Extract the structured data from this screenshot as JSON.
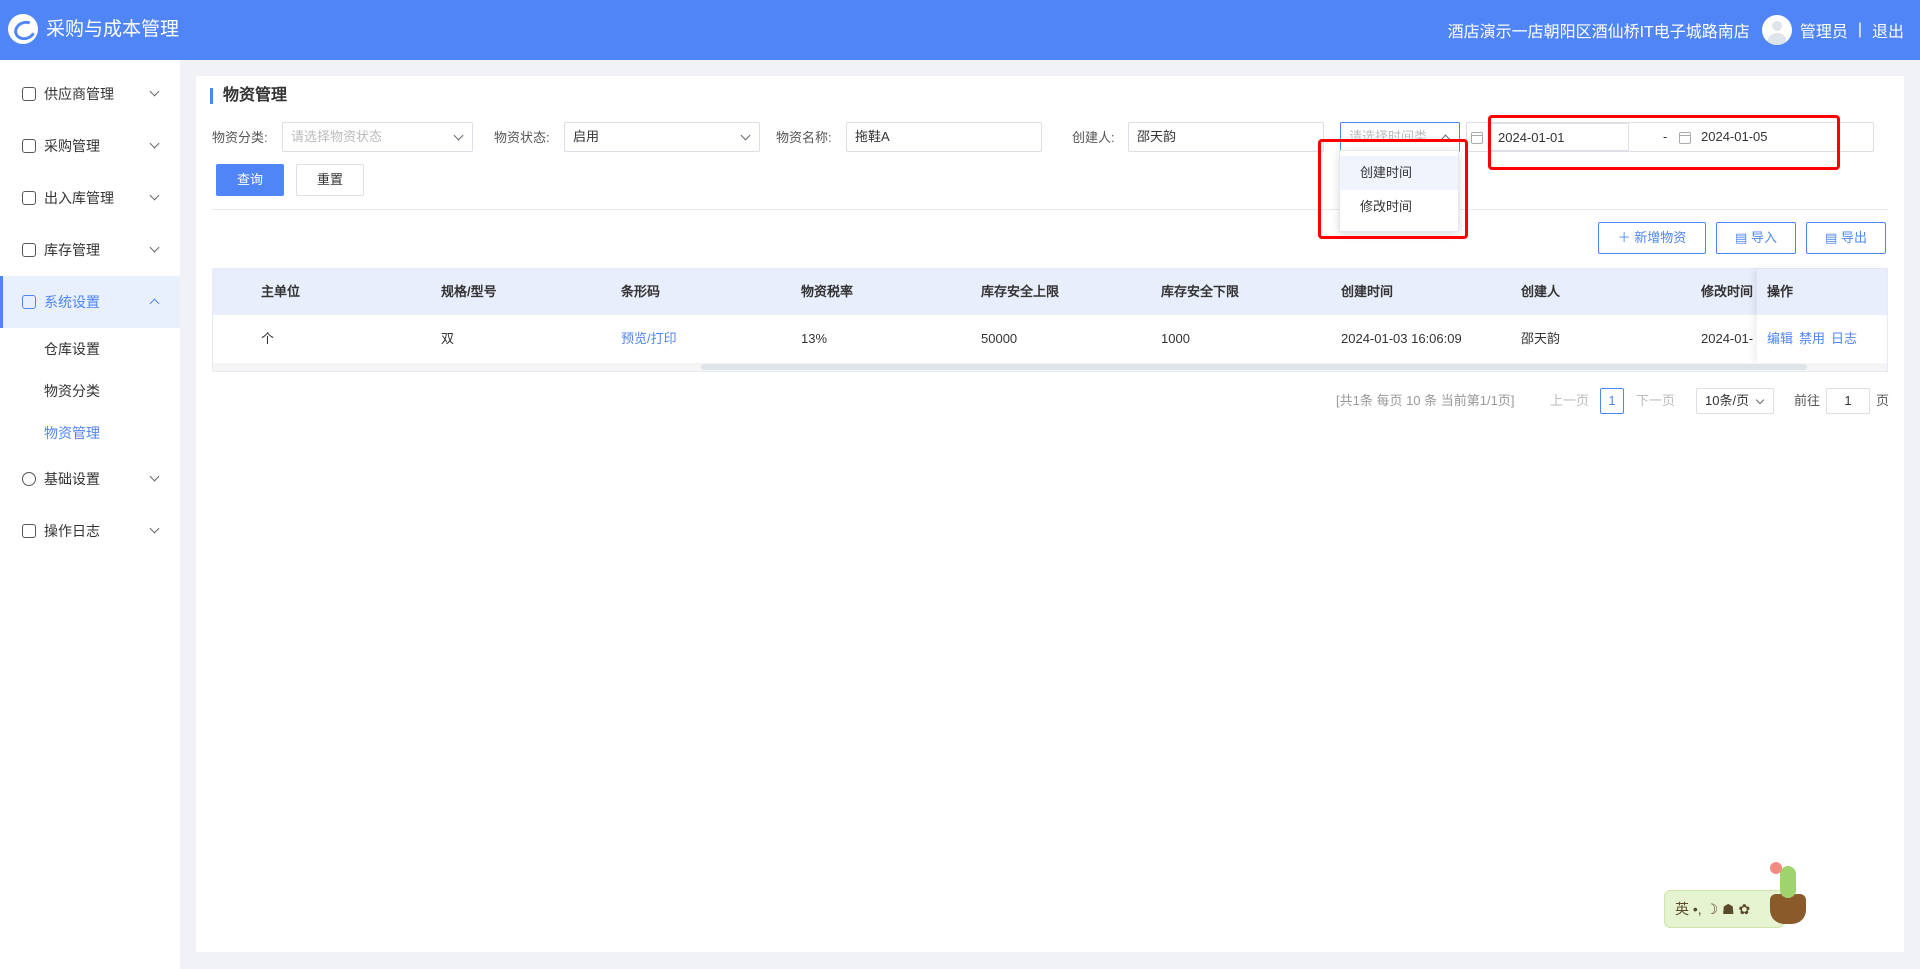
{
  "header": {
    "app_title": "采购与成本管理",
    "store_name": "酒店演示一店朝阳区酒仙桥IT电子城路南店",
    "user": "管理员",
    "separator": "|",
    "logout": "退出"
  },
  "sidebar": {
    "items": [
      {
        "label": "供应商管理",
        "icon": "supplier-icon"
      },
      {
        "label": "采购管理",
        "icon": "purchase-icon"
      },
      {
        "label": "出入库管理",
        "icon": "warehouse-io-icon"
      },
      {
        "label": "库存管理",
        "icon": "inventory-icon"
      },
      {
        "label": "系统设置",
        "icon": "settings-icon",
        "expanded": true
      },
      {
        "label": "基础设置",
        "icon": "gear-icon"
      },
      {
        "label": "操作日志",
        "icon": "log-icon"
      }
    ],
    "sub_items": [
      {
        "label": "仓库设置"
      },
      {
        "label": "物资分类"
      },
      {
        "label": "物资管理",
        "active": true
      }
    ]
  },
  "page": {
    "title": "物资管理"
  },
  "filters": {
    "category_label": "物资分类:",
    "category_placeholder": "请选择物资状态",
    "status_label": "物资状态:",
    "status_value": "启用",
    "name_label": "物资名称:",
    "name_value": "拖鞋A",
    "creator_label": "创建人:",
    "creator_value": "邵天韵",
    "time_type_placeholder": "请选择时间类",
    "date_start": "2024-01-01",
    "date_sep": "-",
    "date_end": "2024-01-05",
    "time_type_options": [
      "创建时间",
      "修改时间"
    ]
  },
  "buttons": {
    "query": "查询",
    "reset": "重置",
    "add": "新增物资",
    "import": "导入",
    "export": "导出"
  },
  "table": {
    "columns": [
      "主单位",
      "规格/型号",
      "条形码",
      "物资税率",
      "库存安全上限",
      "库存安全下限",
      "创建时间",
      "创建人",
      "修改时间",
      "操作"
    ],
    "rows": [
      {
        "unit": "个",
        "spec": "双",
        "barcode": "预览/打印",
        "tax": "13%",
        "upper": "50000",
        "lower": "1000",
        "created": "2024-01-03 16:06:09",
        "creator": "邵天韵",
        "modified": "2024-01-",
        "ops": [
          "编辑",
          "禁用",
          "日志"
        ]
      }
    ]
  },
  "pagination": {
    "summary": "[共1条 每页 10 条 当前第1/1页]",
    "prev": "上一页",
    "current": "1",
    "next": "下一页",
    "page_size": "10条/页",
    "goto_label": "前往",
    "goto_value": "1",
    "page_unit": "页"
  },
  "ime": {
    "text": "英 •, ☽ ☗ ✿"
  },
  "colors": {
    "primary": "#4f85f6",
    "highlight_box": "#ff0000"
  }
}
